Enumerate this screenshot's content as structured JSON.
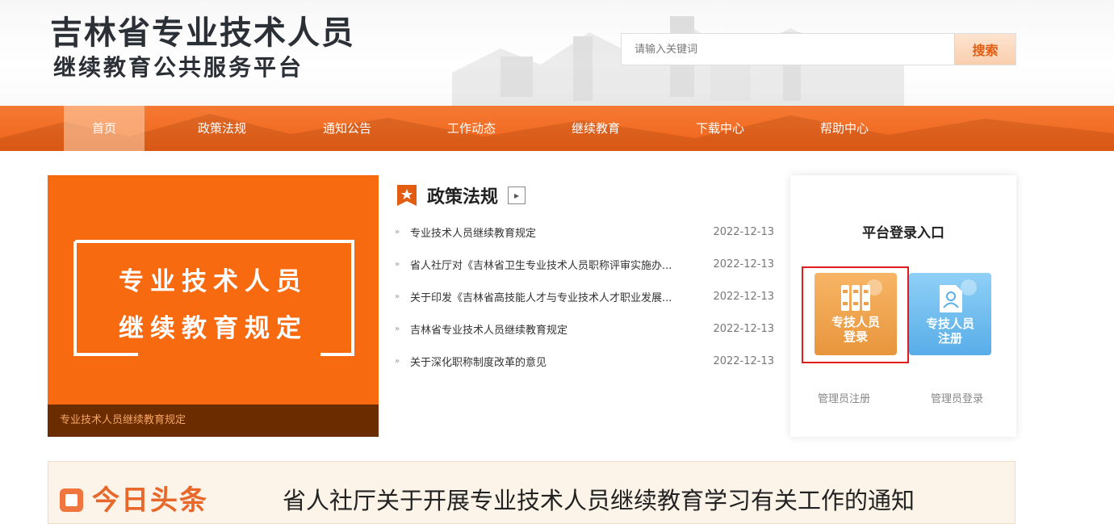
{
  "header": {
    "title": "吉林省专业技术人员",
    "subtitle": "继续教育公共服务平台",
    "search": {
      "placeholder": "请输入关键词",
      "button": "搜索"
    }
  },
  "nav": {
    "items": [
      {
        "label": "首页",
        "active": true
      },
      {
        "label": "政策法规"
      },
      {
        "label": "通知公告"
      },
      {
        "label": "工作动态"
      },
      {
        "label": "继续教育"
      },
      {
        "label": "下载中心"
      },
      {
        "label": "帮助中心"
      }
    ]
  },
  "banner": {
    "line1": "专业技术人员",
    "line2": "继续教育规定",
    "caption": "专业技术人员继续教育规定"
  },
  "news": {
    "title": "政策法规",
    "more_icon": "chevron-right-icon",
    "items": [
      {
        "title": "专业技术人员继续教育规定",
        "date": "2022-12-13"
      },
      {
        "title": "省人社厅对《吉林省卫生专业技术人员职称评审实施办...",
        "date": "2022-12-13"
      },
      {
        "title": "关于印发《吉林省高技能人才与专业技术人才职业发展...",
        "date": "2022-12-13"
      },
      {
        "title": "吉林省专业技术人员继续教育规定",
        "date": "2022-12-13"
      },
      {
        "title": "关于深化职称制度改革的意见",
        "date": "2022-12-13"
      }
    ]
  },
  "login": {
    "title": "平台登录入口",
    "staff_login": {
      "line1": "专技人员",
      "line2": "登录"
    },
    "staff_register": {
      "line1": "专技人员",
      "line2": "注册"
    },
    "admin_register": "管理员注册",
    "admin_login": "管理员登录"
  },
  "headline": {
    "label": "今日头条",
    "text": "省人社厅关于开展专业技术人员继续教育学习有关工作的通知"
  },
  "colors": {
    "accent": "#ef6218",
    "banner": "#f86a10",
    "highlight": "#e11c1c"
  }
}
